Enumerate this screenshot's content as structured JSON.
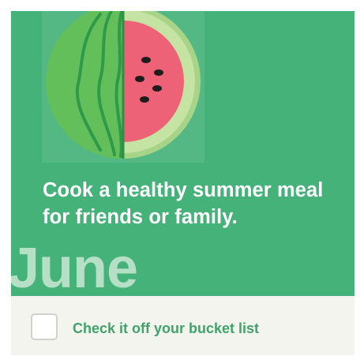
{
  "card": {
    "illustration_icon": "watermelon-slice-icon",
    "headline": "Cook a healthy summer meal for friends or family.",
    "month": "June",
    "checkbox_label": "Check it off your bucket list",
    "checkbox_checked": false
  },
  "colors": {
    "hero_background": "#45b27a",
    "month_text": "#b6e0c6",
    "footer_background": "#f4f4ef",
    "checkbox_label": "#3fa36a"
  }
}
